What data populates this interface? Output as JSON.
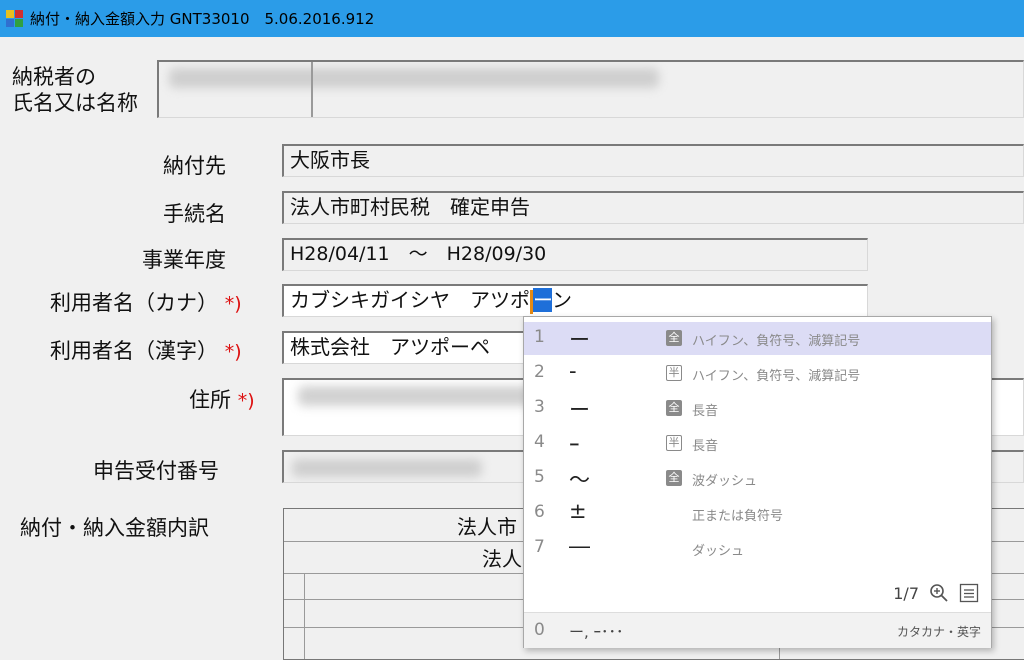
{
  "window": {
    "title": "納付・納入金額入力 GNT33010　5.06.2016.912"
  },
  "form": {
    "taxpayer_label_line1": "納税者の",
    "taxpayer_label_line2": "氏名又は名称",
    "payee_label": "納付先",
    "payee_value": "大阪市長",
    "procedure_label": "手続名",
    "procedure_value": "法人市町村民税　確定申告",
    "fiscal_year_label": "事業年度",
    "fiscal_year_value": "H28/04/11　～　H28/09/30",
    "user_kana_label": "利用者名（カナ）",
    "user_kana_prefix": "カブシキガイシヤ　アツポ",
    "user_kana_cursor": "ー",
    "user_kana_suffix": "ン",
    "user_kanji_label": "利用者名（漢字）",
    "user_kanji_value": "株式会社　アツポーペ",
    "address_label": "住所",
    "receipt_label": "申告受付番号",
    "breakdown_label": "納付・納入金額内訳",
    "breakdown_header1": "法人市",
    "breakdown_header2": "法人",
    "required_mark": "*)"
  },
  "ime": {
    "candidates": [
      {
        "num": "1",
        "char": "ー",
        "badge": "全",
        "desc": "ハイフン、負符号、減算記号"
      },
      {
        "num": "2",
        "char": "-",
        "badge": "半",
        "desc": "ハイフン、負符号、減算記号"
      },
      {
        "num": "3",
        "char": "ー",
        "badge": "全",
        "desc": "長音"
      },
      {
        "num": "4",
        "char": "ｰ",
        "badge": "半",
        "desc": "長音"
      },
      {
        "num": "5",
        "char": "～",
        "badge": "全",
        "desc": "波ダッシュ"
      },
      {
        "num": "6",
        "char": "±",
        "badge": "",
        "desc": "正または負符号"
      },
      {
        "num": "7",
        "char": "―",
        "badge": "",
        "desc": "ダッシュ"
      }
    ],
    "page": "1/7",
    "bottom_num": "0",
    "bottom_chars": "ー, ｰ･･･",
    "bottom_mode": "カタカナ・英字",
    "icons": [
      "zoom-icon",
      "list-icon"
    ]
  }
}
